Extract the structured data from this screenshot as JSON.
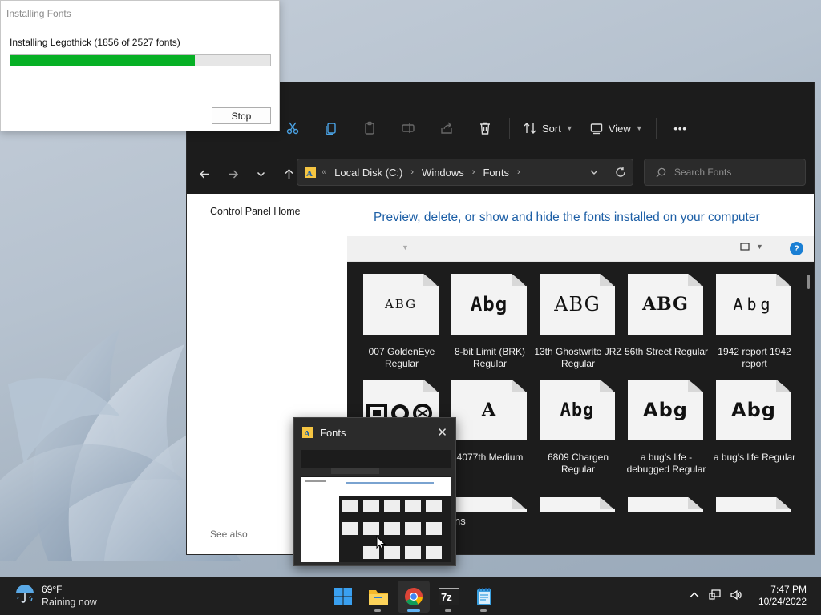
{
  "install_dialog": {
    "title": "Installing Fonts",
    "message": "Installing Legothick (1856 of 2527 fonts)",
    "progress_percent": 71,
    "stop_label": "Stop"
  },
  "explorer": {
    "toolbar": {
      "sort_label": "Sort",
      "view_label": "View",
      "more_label": "•••"
    },
    "address": {
      "overflow": "«",
      "crumbs": [
        "Local Disk (C:)",
        "Windows",
        "Fonts"
      ]
    },
    "search": {
      "placeholder": "Search Fonts"
    },
    "sidebar": {
      "home_link": "Control Panel Home",
      "see_also": "See also"
    },
    "heading": "Preview, delete, or show and hide the fonts installed on your computer",
    "fonts": [
      {
        "sample": "ABG",
        "name": "007 GoldenEye Regular"
      },
      {
        "sample": "Abg",
        "name": "8-bit Limit (BRK) Regular"
      },
      {
        "sample": "ABG",
        "name": "13th Ghostwrite JRZ Regular"
      },
      {
        "sample": "ABG",
        "name": "56th Street Regular"
      },
      {
        "sample": "Abg",
        "name": "1942 report 1942 report"
      },
      {
        "sample": "",
        "name": ""
      },
      {
        "sample": "A",
        "name": "4077th Medium"
      },
      {
        "sample": "Abg",
        "name": "6809 Chargen Regular"
      },
      {
        "sample": "Abg",
        "name": "a bug's life - debugged Regular"
      },
      {
        "sample": "Abg",
        "name": "a bug's life Regular"
      }
    ],
    "partial_text": "ns"
  },
  "preview": {
    "title": "Fonts",
    "close_label": "✕"
  },
  "taskbar": {
    "weather_temp": "69°F",
    "weather_cond": "Raining now",
    "time": "7:47 PM",
    "date": "10/24/2022",
    "apps": [
      "start-icon",
      "file-explorer-icon",
      "chrome-icon",
      "7zip-icon",
      "notepad-icon"
    ]
  },
  "colors": {
    "progress": "#06b025",
    "heading_blue": "#1d5fa6",
    "explorer_dark": "#1c1c1c",
    "taskbar": "#1f1f1f"
  }
}
